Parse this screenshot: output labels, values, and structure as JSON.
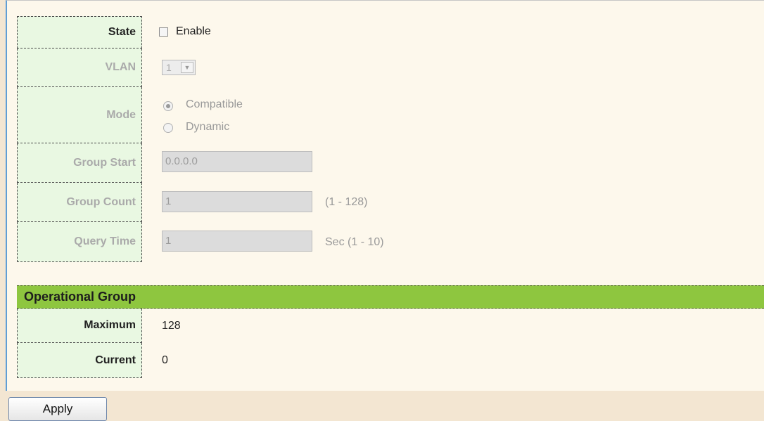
{
  "settings": {
    "state": {
      "label": "State",
      "checkbox_label": "Enable",
      "checked": false
    },
    "vlan": {
      "label": "VLAN",
      "value": "1"
    },
    "mode": {
      "label": "Mode",
      "options": [
        "Compatible",
        "Dynamic"
      ],
      "selected": "Compatible"
    },
    "group_start": {
      "label": "Group Start",
      "value": "0.0.0.0"
    },
    "group_count": {
      "label": "Group Count",
      "value": "1",
      "hint": "(1 - 128)"
    },
    "query_time": {
      "label": "Query Time",
      "value": "1",
      "hint": "Sec (1 - 10)"
    }
  },
  "operational_group": {
    "title": "Operational Group",
    "maximum": {
      "label": "Maximum",
      "value": "128"
    },
    "current": {
      "label": "Current",
      "value": "0"
    }
  },
  "apply_label": "Apply",
  "colors": {
    "label_bg": "#e9f8e2",
    "section_bar": "#8ec63f",
    "content_bg": "#fdf8ec",
    "page_bg": "#f3e6d2"
  }
}
